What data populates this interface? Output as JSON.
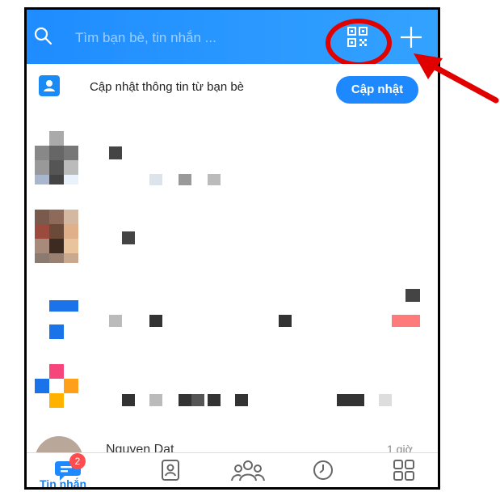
{
  "search": {
    "placeholder": "Tìm bạn bè, tin nhắn ..."
  },
  "update_banner": {
    "text": "Cập nhật thông tin từ bạn bè",
    "button_label": "Cập nhật"
  },
  "last_item": {
    "name": "Nguyen Dat",
    "time": "1 giờ"
  },
  "bottom_nav": {
    "active_label": "Tin nhắn",
    "badge_count": "2",
    "items": [
      "messages-icon",
      "contacts-icon",
      "groups-icon",
      "timeline-icon",
      "more-grid-icon"
    ]
  },
  "colors": {
    "accent": "#1e88ff",
    "highlight": "#e00000",
    "badge": "#ff4d4f"
  }
}
